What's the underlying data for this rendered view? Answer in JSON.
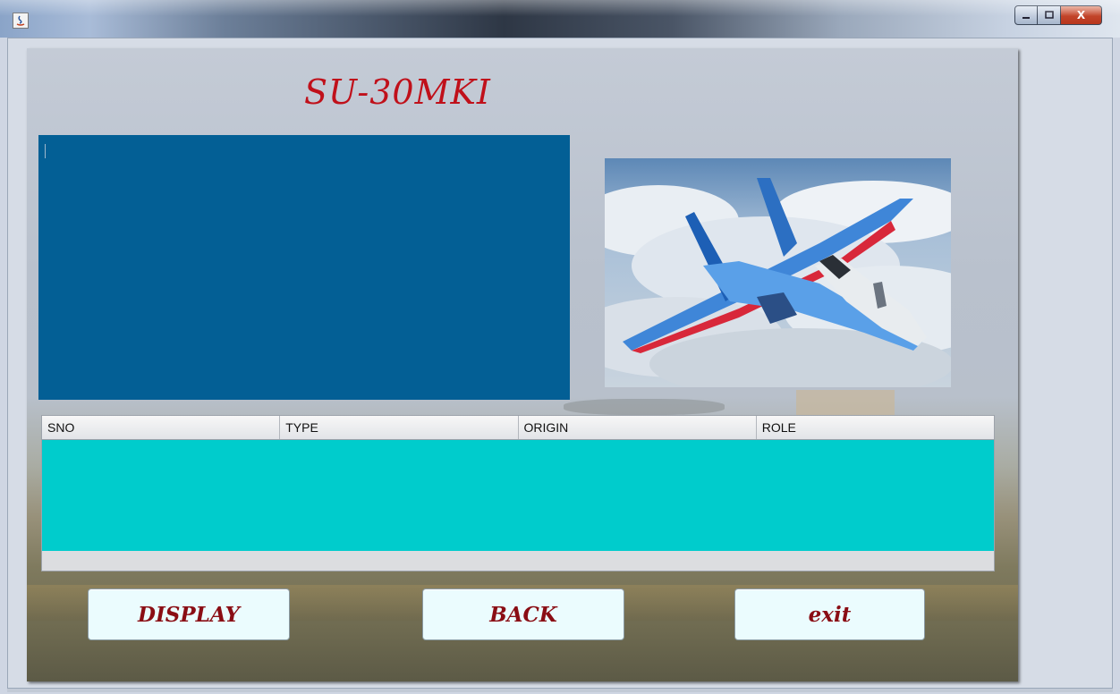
{
  "window": {
    "title": "",
    "controls": [
      "minimize",
      "maximize",
      "close"
    ],
    "close_symbol": "X"
  },
  "main": {
    "title": "SU-30MKI",
    "text_area": {
      "value": ""
    },
    "image": {
      "subject": "Su-30 fighter jet in flight against clouds"
    }
  },
  "table": {
    "columns": [
      "SNO",
      "TYPE",
      "ORIGIN",
      "ROLE"
    ],
    "rows": []
  },
  "buttons": {
    "display": "DISPLAY",
    "back": "BACK",
    "exit": "exit"
  },
  "colors": {
    "title": "#c0101a",
    "text_area": "#035f95",
    "table_body": "#00cccc",
    "button_bg": "#ebfcfe",
    "button_text": "#8a0d14"
  }
}
